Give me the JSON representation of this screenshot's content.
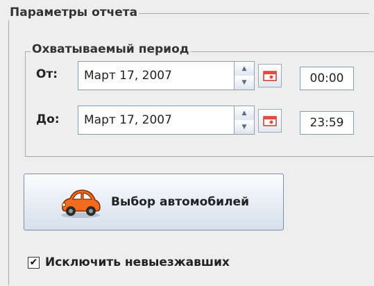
{
  "report_params": {
    "title": "Параметры отчета",
    "period": {
      "title": "Охватываемый период",
      "from": {
        "label": "От:",
        "date": "Март 17, 2007",
        "time": "00:00"
      },
      "to": {
        "label": "До:",
        "date": "Март 17, 2007",
        "time": "23:59"
      }
    },
    "select_vehicles_button": "Выбор автомобилей",
    "exclude_inactive": {
      "label": "Исключить невыезжавших",
      "checked": true,
      "mark": "✔"
    }
  },
  "icons": {
    "spinner_up": "triangle-up",
    "spinner_down": "triangle-down",
    "calendar": "calendar-icon",
    "car": "car-icon"
  },
  "colors": {
    "background": "#eeeeee",
    "border": "#a9a9a9",
    "input_border": "#7f9db9",
    "car": "#f36b1c"
  }
}
